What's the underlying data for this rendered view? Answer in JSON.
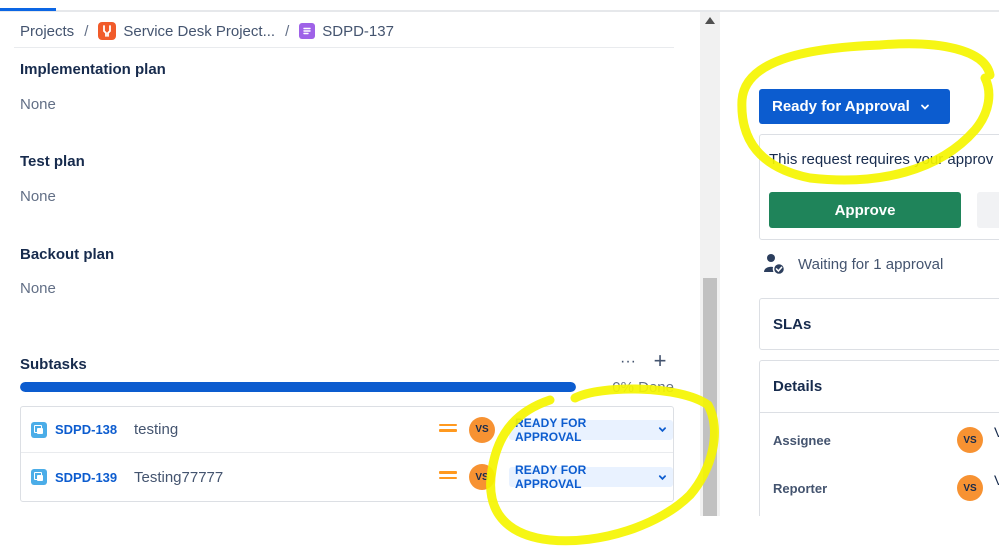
{
  "breadcrumb": {
    "projects": "Projects",
    "separator": "/",
    "project_name": "Service Desk Project...",
    "issue_key": "SDPD-137"
  },
  "fields": [
    {
      "label": "Implementation plan",
      "value": "None"
    },
    {
      "label": "Test plan",
      "value": "None"
    },
    {
      "label": "Backout plan",
      "value": "None"
    }
  ],
  "subtasks": {
    "title": "Subtasks",
    "more": "···",
    "add": "+",
    "progress_percent": 0,
    "progress_label": "0% Done",
    "items": [
      {
        "key": "SDPD-138",
        "summary": "testing",
        "assignee_initials": "VS",
        "status": "READY FOR APPROVAL"
      },
      {
        "key": "SDPD-139",
        "summary": "Testing77777",
        "assignee_initials": "VS",
        "status": "READY FOR APPROVAL"
      }
    ]
  },
  "sidebar": {
    "status_button": "Ready for Approval",
    "approval_message": "This request requires your approv",
    "approve_button": "Approve",
    "waiting_text": "Waiting for 1 approval",
    "slas_title": "SLAs",
    "details_title": "Details",
    "assignee_label": "Assignee",
    "assignee_initials": "VS",
    "assignee_name": "V S",
    "reporter_label": "Reporter",
    "reporter_initials": "VS",
    "reporter_name": "V S"
  },
  "colors": {
    "primary_blue": "#0c5ccf",
    "approve_green": "#1f845a",
    "avatar_orange": "#f79232",
    "priority_medium": "#ff991f",
    "highlight_yellow": "#f5f500"
  },
  "icons": [
    "project-icon",
    "issue-type-icon",
    "more-icon",
    "add-icon",
    "subtask-icon",
    "priority-medium-icon",
    "chevron-down-icon",
    "approver-icon",
    "scroll-up-icon"
  ]
}
